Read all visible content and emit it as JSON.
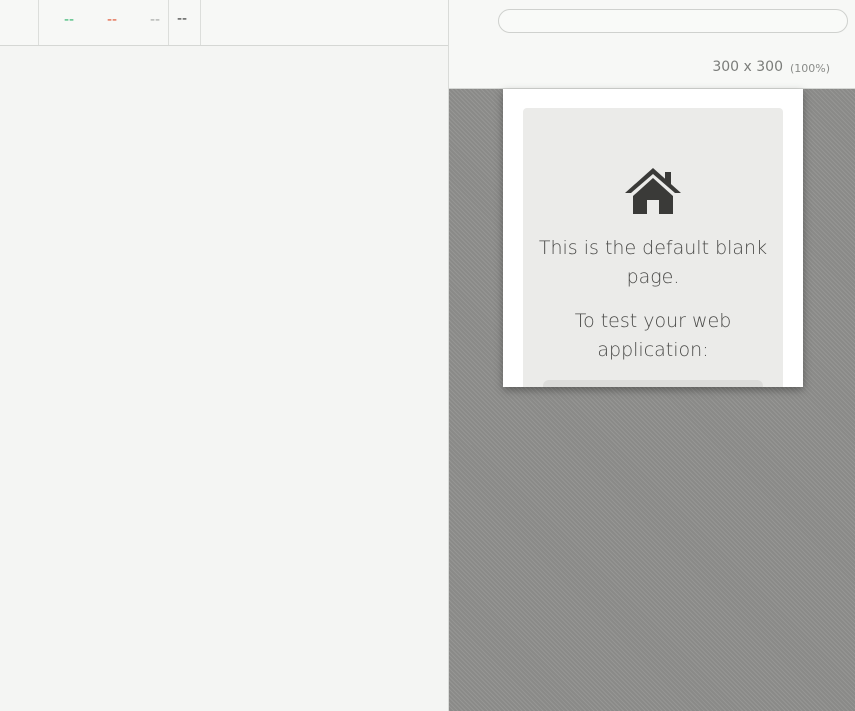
{
  "reporter": {
    "stats": {
      "passed": "--",
      "failed": "--",
      "pending": "--",
      "duration": "--"
    },
    "colors": {
      "passed": "#2fb36b",
      "failed": "#e0522f",
      "pending": "#a5a7a4"
    }
  },
  "aut": {
    "url": "",
    "viewport": {
      "size": "300 x 300",
      "scale": "(100%)"
    },
    "blank_page": {
      "icon": "home-icon",
      "line1": "This is the default blank page.",
      "line2": "To test your web application:"
    }
  }
}
